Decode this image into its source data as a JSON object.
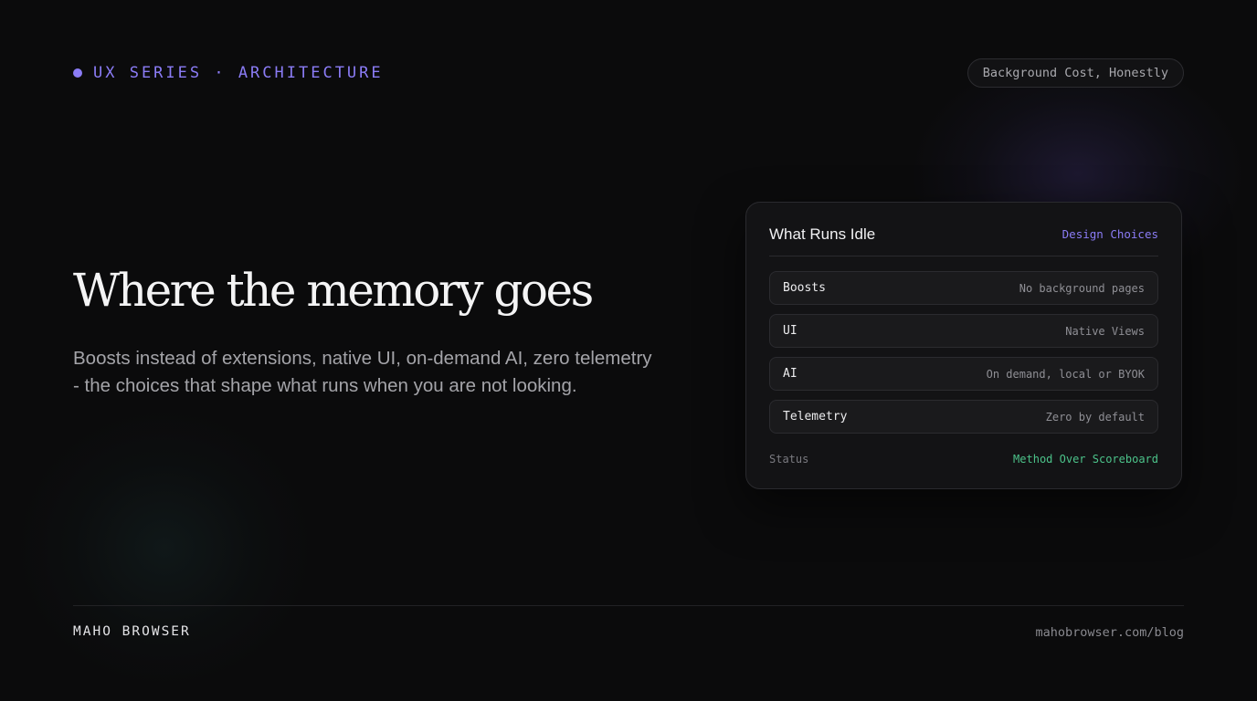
{
  "header": {
    "eyebrow": "UX SERIES · ARCHITECTURE",
    "pill": "Background Cost, Honestly"
  },
  "hero": {
    "title": "Where the memory goes",
    "subtitle": "Boosts instead of extensions, native UI, on-demand AI, zero telemetry - the choices that shape what runs when you are not looking."
  },
  "card": {
    "title": "What Runs Idle",
    "tag": "Design Choices",
    "rows": [
      {
        "label": "Boosts",
        "value": "No background pages"
      },
      {
        "label": "UI",
        "value": "Native Views"
      },
      {
        "label": "AI",
        "value": "On demand, local or BYOK"
      },
      {
        "label": "Telemetry",
        "value": "Zero by default"
      }
    ],
    "status_label": "Status",
    "status_value": "Method Over Scoreboard"
  },
  "footer": {
    "brand": "MAHO BROWSER",
    "link": "mahobrowser.com/blog"
  },
  "colors": {
    "accent": "#8b7cf6",
    "status_green": "#4cc38a",
    "background": "#0b0b0c"
  }
}
